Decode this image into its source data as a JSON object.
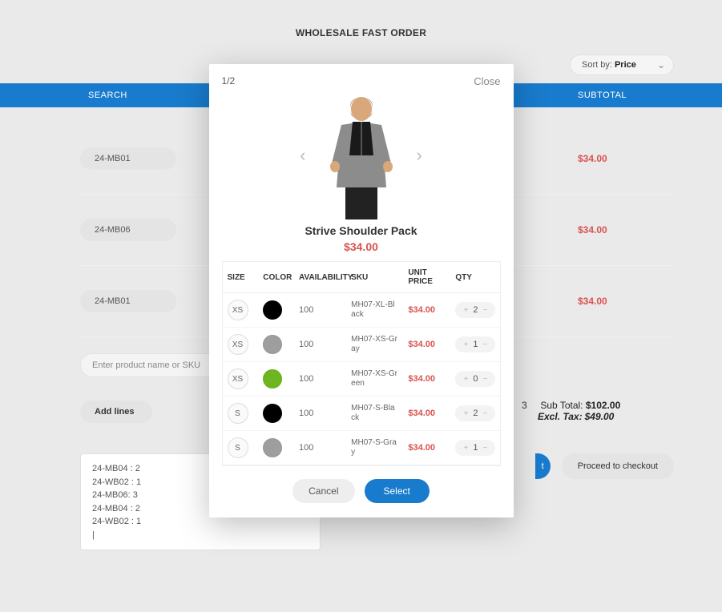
{
  "page": {
    "title": "WHOLESALE FAST ORDER"
  },
  "sort": {
    "label": "Sort by:",
    "value": "Price"
  },
  "header": {
    "search": "SEARCH",
    "subtotal": "SUBTOTAL"
  },
  "rows": [
    {
      "sku": "24-MB01",
      "subtotal": "$34.00"
    },
    {
      "sku": "24-MB06",
      "subtotal": "$34.00"
    },
    {
      "sku": "24-MB01",
      "subtotal": "$34.00"
    }
  ],
  "search": {
    "placeholder": "Enter product name or SKU"
  },
  "addLines": {
    "label": "Add lines"
  },
  "totals": {
    "trail_num": "3",
    "subtotal_label": "Sub Total:",
    "subtotal_value": "$102.00",
    "excl_label": "Excl. Tax:",
    "excl_value": "$49.00"
  },
  "log": [
    "24-MB04 : 2",
    "24-WB02 : 1",
    "24-MB06: 3",
    "24-MB04 : 2",
    "24-WB02 : 1",
    "|"
  ],
  "bottom": {
    "cart_trail": "t",
    "checkout": "Proceed to checkout"
  },
  "modal": {
    "pager": "1/2",
    "close": "Close",
    "title": "Strive Shoulder Pack",
    "price": "$34.00",
    "cols": {
      "size": "SIZE",
      "color": "COLOR",
      "avail": "AVAILABILITY",
      "sku": "SKU",
      "unit": "UNIT PRICE",
      "qty": "QTY"
    },
    "variants": [
      {
        "size": "XS",
        "color": "#000000",
        "availability": "100",
        "sku": "MH07-XL-Black",
        "unit_price": "$34.00",
        "qty": "2"
      },
      {
        "size": "XS",
        "color": "#9e9e9e",
        "availability": "100",
        "sku": "MH07-XS-Gray",
        "unit_price": "$34.00",
        "qty": "1"
      },
      {
        "size": "XS",
        "color": "#6db61f",
        "availability": "100",
        "sku": "MH07-XS-Green",
        "unit_price": "$34.00",
        "qty": "0"
      },
      {
        "size": "S",
        "color": "#000000",
        "availability": "100",
        "sku": "MH07-S-Black",
        "unit_price": "$34.00",
        "qty": "2"
      },
      {
        "size": "S",
        "color": "#9e9e9e",
        "availability": "100",
        "sku": "MH07-S-Gray",
        "unit_price": "$34.00",
        "qty": "1"
      }
    ],
    "actions": {
      "cancel": "Cancel",
      "select": "Select"
    }
  }
}
